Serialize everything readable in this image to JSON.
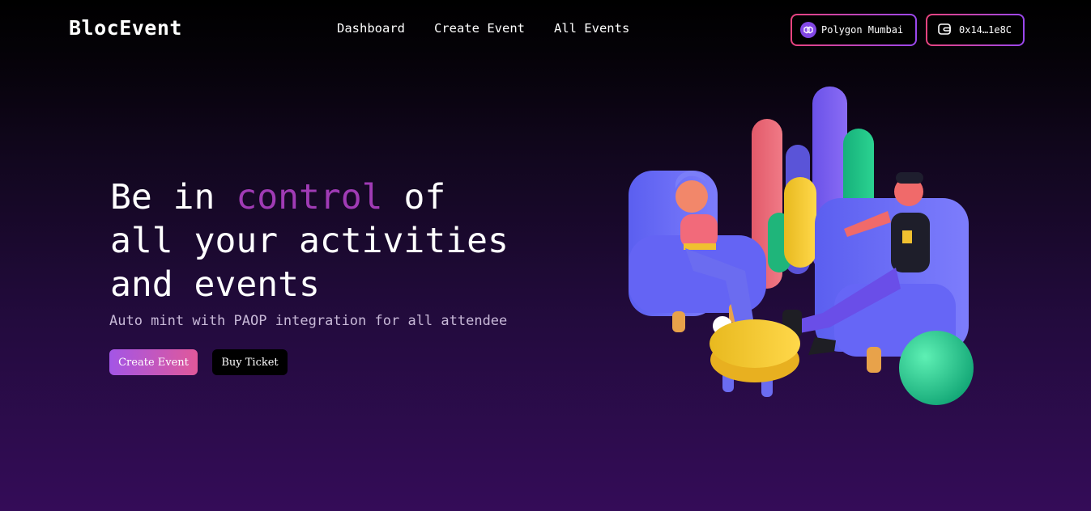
{
  "brand": {
    "logo": "BlocEvent"
  },
  "nav": {
    "items": [
      {
        "label": "Dashboard"
      },
      {
        "label": "Create Event"
      },
      {
        "label": "All Events"
      }
    ]
  },
  "header": {
    "network": {
      "label": "Polygon Mumbai",
      "icon": "polygon-icon"
    },
    "wallet": {
      "label": "0x14…1e8C",
      "icon": "wallet-icon"
    }
  },
  "hero": {
    "title_part1": "Be in ",
    "title_accent": "control",
    "title_part2": " of",
    "title_line2": "all your activities",
    "title_line3": "and events",
    "subtitle": "Auto mint with PAOP integration for all attendee",
    "create_button": "Create Event",
    "buy_button": "Buy Ticket"
  },
  "colors": {
    "accent": "#a03bb5",
    "gradient_start": "#a356e6",
    "gradient_end": "#e0589a",
    "border_pink": "#e8437e",
    "border_purple": "#9a47ee"
  }
}
